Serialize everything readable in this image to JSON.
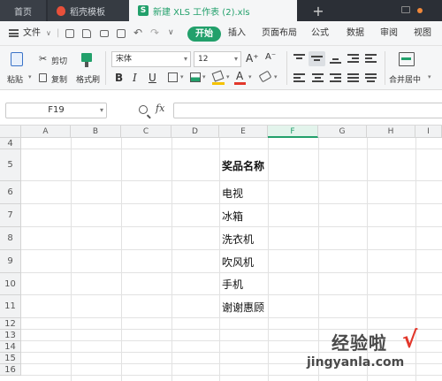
{
  "tabs": {
    "home": "首页",
    "template": "稻壳模板",
    "active_file": "新建 XLS 工作表 (2).xls",
    "add": "+"
  },
  "menu": {
    "file": "文件",
    "start": "开始",
    "items": [
      "插入",
      "页面布局",
      "公式",
      "数据",
      "审阅",
      "视图"
    ]
  },
  "ribbon": {
    "paste": "粘贴",
    "cut": "剪切",
    "copy": "复制",
    "format_painter": "格式刷",
    "font_name": "宋体",
    "font_size": "12",
    "bold": "B",
    "italic": "I",
    "underline": "U",
    "font_color_glyph": "A",
    "grow_font": "A⁺",
    "shrink_font": "A⁻",
    "merge_center": "合并居中"
  },
  "formula_bar": {
    "cell_ref": "F19",
    "fx": "fx",
    "value": ""
  },
  "grid": {
    "columns": [
      "A",
      "B",
      "C",
      "D",
      "E",
      "F",
      "G",
      "H",
      "I"
    ],
    "active_column": "F",
    "rows": [
      {
        "num": "4",
        "e": ""
      },
      {
        "num": "5",
        "e": "奖品名称"
      },
      {
        "num": "6",
        "e": "电视"
      },
      {
        "num": "7",
        "e": "冰箱"
      },
      {
        "num": "8",
        "e": "洗衣机"
      },
      {
        "num": "9",
        "e": "吹风机"
      },
      {
        "num": "10",
        "e": "手机"
      },
      {
        "num": "11",
        "e": "谢谢惠顾"
      },
      {
        "num": "12",
        "e": ""
      },
      {
        "num": "13",
        "e": ""
      },
      {
        "num": "14",
        "e": ""
      },
      {
        "num": "15",
        "e": ""
      },
      {
        "num": "16",
        "e": ""
      }
    ]
  },
  "watermark": {
    "title": "经验啦",
    "check": "√",
    "url": "jingyanla.com"
  },
  "colors": {
    "accent_green": "#22a06b",
    "tab_bar_dark": "#2b2f36",
    "watermark_red": "#e2372b"
  }
}
